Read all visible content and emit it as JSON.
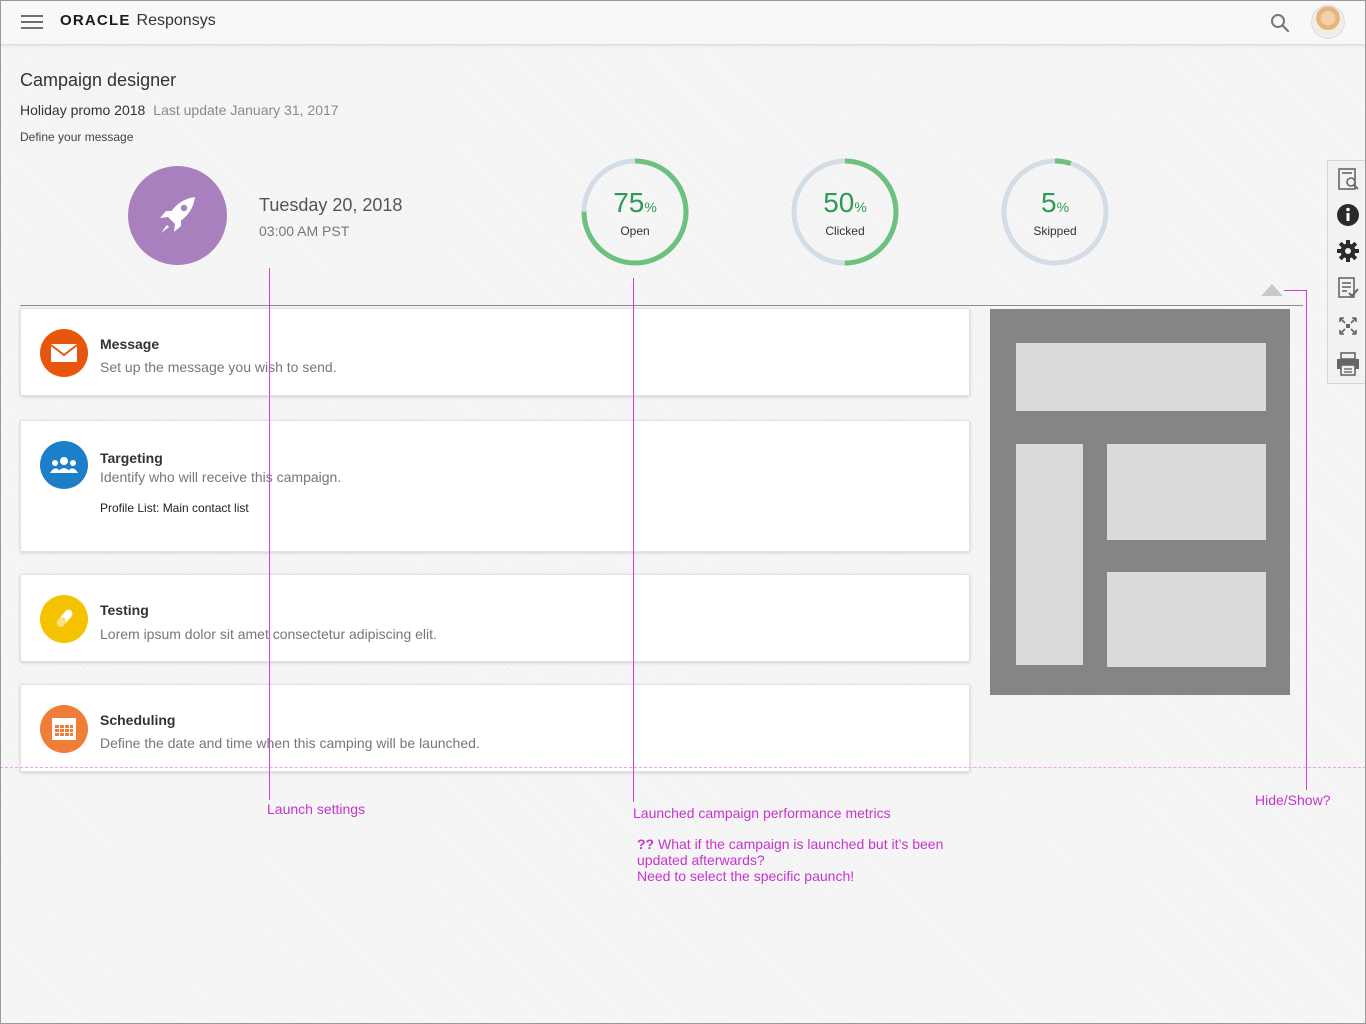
{
  "header": {
    "brand": "ORACLE",
    "product": "Responsys"
  },
  "page": {
    "title": "Campaign designer",
    "campaign_name": "Holiday promo 2018",
    "last_update": "Last update January 31, 2017",
    "subtitle": "Define your message"
  },
  "launch": {
    "date": "Tuesday 20, 2018",
    "time": "03:00 AM PST",
    "icon": "rocket-icon",
    "color": "#a880bd"
  },
  "metrics": [
    {
      "value": "75",
      "unit": "%",
      "label": "Open",
      "fraction": 0.75
    },
    {
      "value": "50",
      "unit": "%",
      "label": "Clicked",
      "fraction": 0.5
    },
    {
      "value": "5",
      "unit": "%",
      "label": "Skipped",
      "fraction": 0.05
    }
  ],
  "metric_colors": {
    "progress": "#6cc17e",
    "track": "#d4dde6",
    "text": "#2e9a55"
  },
  "steps": [
    {
      "title": "Message",
      "description": "Set up the message you wish to send.",
      "icon": "envelope-icon",
      "color": "#e8560e"
    },
    {
      "title": "Targeting",
      "description": "Identify who will receive this campaign.",
      "extra": "Profile List: Main contact list",
      "icon": "people-icon",
      "color": "#1e7fc9"
    },
    {
      "title": "Testing",
      "description": "Lorem ipsum dolor sit amet consectetur adipiscing elit.",
      "icon": "test-tube-icon",
      "color": "#f5c200"
    },
    {
      "title": "Scheduling",
      "description": "Define the date and time when this camping will be launched.",
      "icon": "calendar-icon",
      "color": "#ef7d37"
    }
  ],
  "rail": [
    "preview-search-icon",
    "info-icon",
    "gear-icon",
    "checklist-icon",
    "expand-icon",
    "print-icon"
  ],
  "annotations": {
    "launch_settings": "Launch settings",
    "metrics_note": "Launched campaign performance metrics",
    "hide_show": "Hide/Show?",
    "question_mark": "??",
    "question_line1": "What if the campaign is launched but it’s been",
    "question_line2": "updated afterwards?",
    "question_line3": "Need to select the specific paunch!",
    "color": "#d23fd8"
  }
}
